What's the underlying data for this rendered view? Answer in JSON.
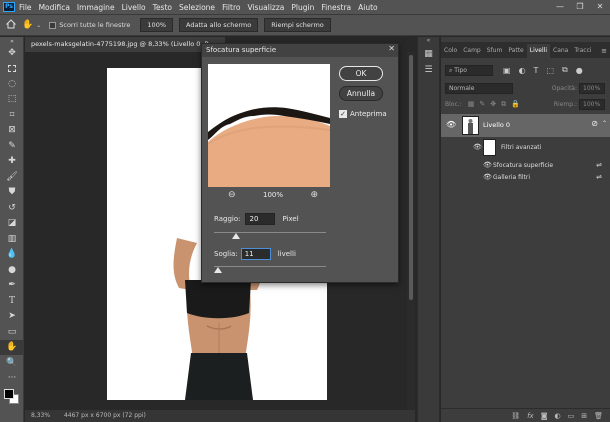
{
  "menu": {
    "logo": "Ps",
    "items": [
      "File",
      "Modifica",
      "Immagine",
      "Livello",
      "Testo",
      "Selezione",
      "Filtro",
      "Visualizza",
      "Plugin",
      "Finestra",
      "Aiuto"
    ]
  },
  "window_controls": [
    "—",
    "❐",
    "✕"
  ],
  "options_bar": {
    "scroll_all_label": "Scorri tutte le finestre",
    "zoom_100": "100%",
    "fit_screen": "Adatta allo schermo",
    "fill_screen": "Riempi schermo"
  },
  "document": {
    "tab_title": "pexels-maksgelatin-4775198.jpg @ 8,33% (Livello 0, R",
    "status_zoom": "8,33%",
    "status_info": "4467 px x 6700 px (72 ppi)"
  },
  "dialog": {
    "title": "Sfocatura superficie",
    "close": "✕",
    "ok_label": "OK",
    "cancel_label": "Annulla",
    "preview_label": "Anteprima",
    "preview_checked": true,
    "zoom_out": "⊖",
    "zoom_level": "100%",
    "zoom_in": "⊕",
    "radius_label": "Raggio:",
    "radius_value": "20",
    "radius_unit": "Pixel",
    "radius_slider_fraction": 0.2,
    "threshold_label": "Soglia:",
    "threshold_value": "11",
    "threshold_unit": "livelli",
    "threshold_slider_fraction": 0.04
  },
  "layers_panel": {
    "tabs": [
      "Colo",
      "Camp",
      "Sfum",
      "Patte",
      "Livelli",
      "Cana",
      "Tracci"
    ],
    "active_tab": "Livelli",
    "filter_label": "Tipo",
    "blend_mode": "Normale",
    "opacity_label": "Opacità:",
    "opacity_value": "100%",
    "lock_label": "Bloc.:",
    "fill_label": "Riemp.:",
    "fill_value": "100%",
    "layer_name": "Livello 0",
    "smart_filters_label": "Filtri avanzati",
    "filters": [
      "Sfocatura superficie",
      "Galleria filtri"
    ]
  },
  "colors": {
    "accent": "#31a8ff",
    "panel_bg": "#535353",
    "selected_layer": "#666666"
  }
}
